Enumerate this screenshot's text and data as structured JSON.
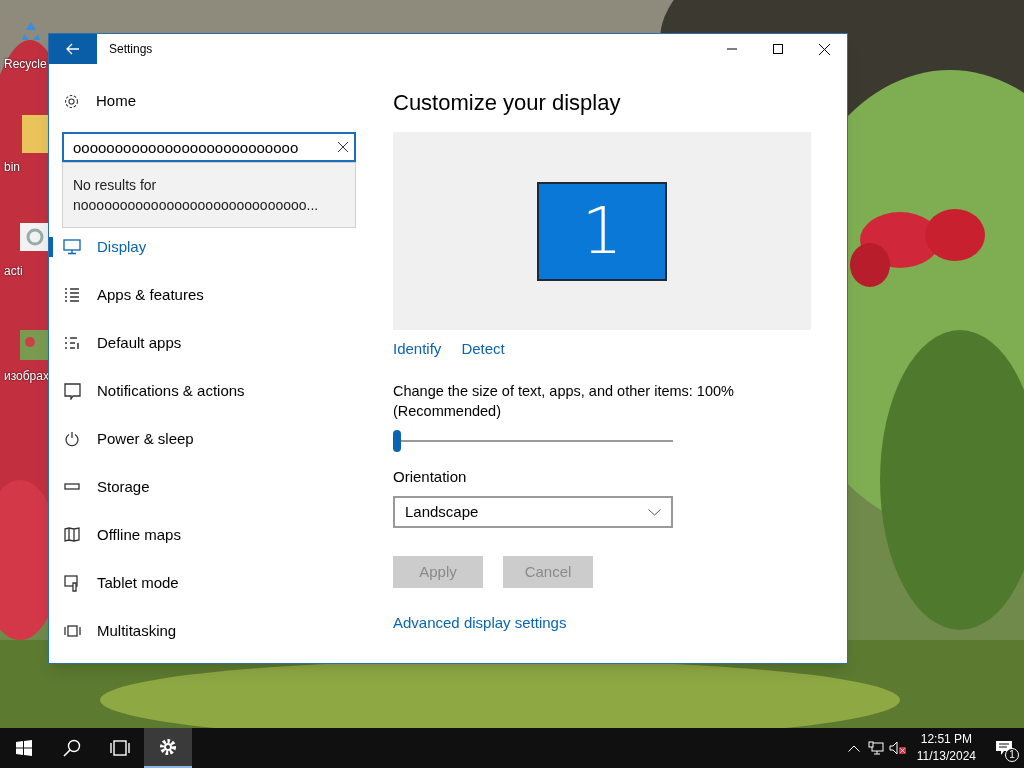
{
  "desktop": {
    "icons": [
      {
        "label": "Recycle"
      },
      {
        "label": "bin"
      },
      {
        "label": "acti"
      },
      {
        "label": "изобрах"
      }
    ]
  },
  "window": {
    "title": "Settings"
  },
  "sidebar": {
    "home": "Home",
    "search": {
      "value": "ooooooooooooooooooooooooooo",
      "no_results": "No results for",
      "query": "nooooooooooooooooooooooooooooo..."
    },
    "items": [
      {
        "label": "Display",
        "selected": true
      },
      {
        "label": "Apps & features",
        "selected": false
      },
      {
        "label": "Default apps",
        "selected": false
      },
      {
        "label": "Notifications & actions",
        "selected": false
      },
      {
        "label": "Power & sleep",
        "selected": false
      },
      {
        "label": "Storage",
        "selected": false
      },
      {
        "label": "Offline maps",
        "selected": false
      },
      {
        "label": "Tablet mode",
        "selected": false
      },
      {
        "label": "Multitasking",
        "selected": false
      }
    ]
  },
  "content": {
    "heading": "Customize your display",
    "monitor": "1",
    "links": [
      "Identify",
      "Detect"
    ],
    "scale": {
      "label": "Change the size of text, apps, and other items: 100% (Recommended)",
      "level": 0
    },
    "orientation": {
      "label": "Orientation",
      "value": "Landscape"
    },
    "buttons": [
      {
        "label": "Apply",
        "disabled": true
      },
      {
        "label": "Cancel",
        "disabled": true
      }
    ],
    "advanced_link": "Advanced display settings"
  },
  "taskbar": {
    "apps": [
      {
        "selected": false
      },
      {
        "selected": false
      },
      {
        "selected": false
      },
      {
        "selected": true
      }
    ],
    "time": "12:51 PM",
    "date": "11/13/2024",
    "notifications": "1"
  }
}
